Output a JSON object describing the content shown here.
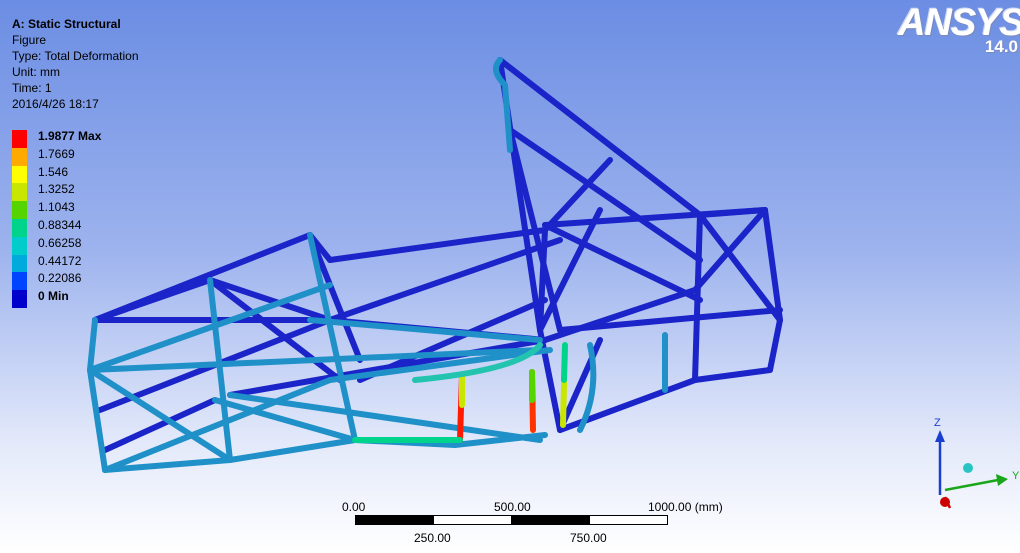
{
  "info": {
    "title": "A: Static Structural",
    "line2": "Figure",
    "type": "Type: Total Deformation",
    "unit": "Unit: mm",
    "time": "Time: 1",
    "date": "2016/4/26 18:17"
  },
  "legend": {
    "items": [
      {
        "label": "1.9877 Max",
        "color": "#ff0000",
        "bold": true
      },
      {
        "label": "1.7669",
        "color": "#ffaa00"
      },
      {
        "label": "1.546",
        "color": "#ffff00"
      },
      {
        "label": "1.3252",
        "color": "#c8e600"
      },
      {
        "label": "1.1043",
        "color": "#55d400"
      },
      {
        "label": "0.88344",
        "color": "#00d48c"
      },
      {
        "label": "0.66258",
        "color": "#00cccc"
      },
      {
        "label": "0.44172",
        "color": "#00aadd"
      },
      {
        "label": "0.22086",
        "color": "#0044ff"
      },
      {
        "label": "0 Min",
        "color": "#0000cc",
        "bold": true
      }
    ]
  },
  "logo": {
    "brand": "ANSYS",
    "version": "14.0"
  },
  "scale": {
    "top_left": "0.00",
    "top_mid": "500.00",
    "top_right": "1000.00 (mm)",
    "bottom_left": "250.00",
    "bottom_right": "750.00"
  },
  "triad": {
    "z": "Z",
    "y": "Y"
  },
  "colors": {
    "frame_dark": "#1a1fb8",
    "frame_cyan": "#1f8fc4",
    "hot_red": "#ff1a00"
  }
}
